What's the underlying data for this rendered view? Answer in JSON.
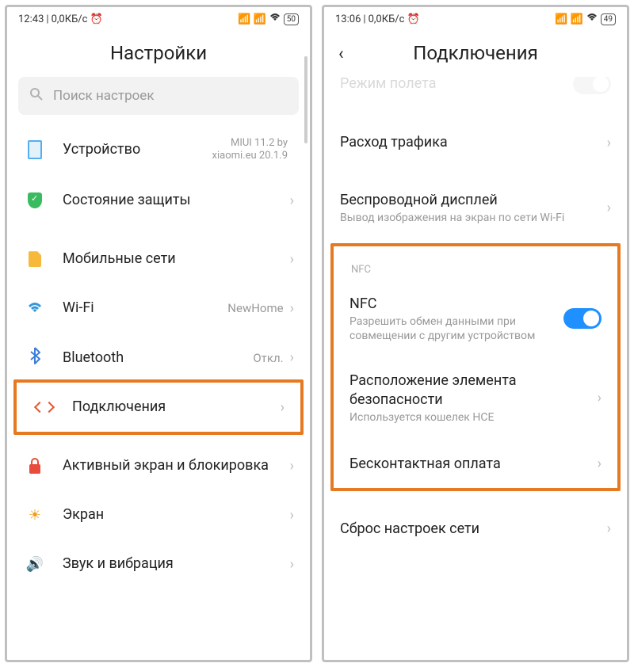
{
  "left": {
    "status": {
      "time": "12:43",
      "data": "0,0КБ/с",
      "battery": "50"
    },
    "title": "Настройки",
    "search_placeholder": "Поиск настроек",
    "items": [
      {
        "icon": "phone-icon",
        "label": "Устройство",
        "value": "MIUI 11.2 by xiaomi.eu 20.1.9"
      },
      {
        "icon": "shield-icon",
        "label": "Состояние защиты",
        "value": ""
      }
    ],
    "group2": [
      {
        "icon": "sim-icon",
        "label": "Мобильные сети",
        "value": ""
      },
      {
        "icon": "wifi-icon",
        "label": "Wi-Fi",
        "value": "NewHome"
      },
      {
        "icon": "bluetooth-icon",
        "label": "Bluetooth",
        "value": "Откл."
      },
      {
        "icon": "connection-icon",
        "label": "Подключения",
        "value": ""
      }
    ],
    "group3": [
      {
        "icon": "lock-icon",
        "label": "Активный экран и блокировка",
        "value": ""
      },
      {
        "icon": "sun-icon",
        "label": "Экран",
        "value": ""
      },
      {
        "icon": "sound-icon",
        "label": "Звук и вибрация",
        "value": ""
      }
    ]
  },
  "right": {
    "status": {
      "time": "13:06",
      "data": "0,0КБ/с",
      "battery": "49"
    },
    "title": "Подключения",
    "partial_top": "Режим полета",
    "items": [
      {
        "label": "Расход трафика",
        "sub": ""
      },
      {
        "label": "Беспроводной дисплей",
        "sub": "Вывод изображения на экран по сети Wi-Fi"
      }
    ],
    "nfc_header": "NFC",
    "nfc_items": [
      {
        "label": "NFC",
        "sub": "Разрешить обмен данными при совмещении с другим устройством",
        "toggle": true
      },
      {
        "label": "Расположение элемента безопасности",
        "sub": "Используется кошелек HCE"
      },
      {
        "label": "Бесконтактная оплата",
        "sub": ""
      }
    ],
    "reset": "Сброс настроек сети"
  }
}
